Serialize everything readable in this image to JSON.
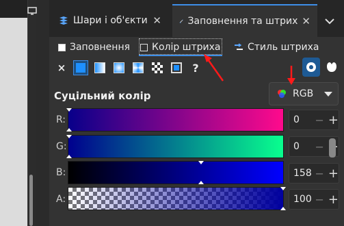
{
  "tabs": [
    {
      "label": "Шари і об'єкти",
      "close": "✕"
    },
    {
      "label": "Заповнення та штрих",
      "close": "✕"
    }
  ],
  "subtabs": [
    {
      "label": "Заповнення"
    },
    {
      "label": "Колір штриха"
    },
    {
      "label": "Стиль штриха"
    }
  ],
  "fill_buttons": {
    "none": "×",
    "unset": "?"
  },
  "heading": "Суцільний колір",
  "color_mode": "RGB",
  "channels": [
    {
      "label": "R:",
      "value": "0"
    },
    {
      "label": "G:",
      "value": "0"
    },
    {
      "label": "B:",
      "value": "158"
    },
    {
      "label": "A:",
      "value": "100"
    }
  ],
  "colors": {
    "accent": "#3d8ee8",
    "annotation": "#ff1a1a",
    "panel_bg": "#333333"
  },
  "icons": [
    "monitor-icon",
    "layers-icon",
    "fill-stroke-icon",
    "stroke-style-icon",
    "color-wheel-icon",
    "swatches-icon",
    "mask-icon"
  ]
}
